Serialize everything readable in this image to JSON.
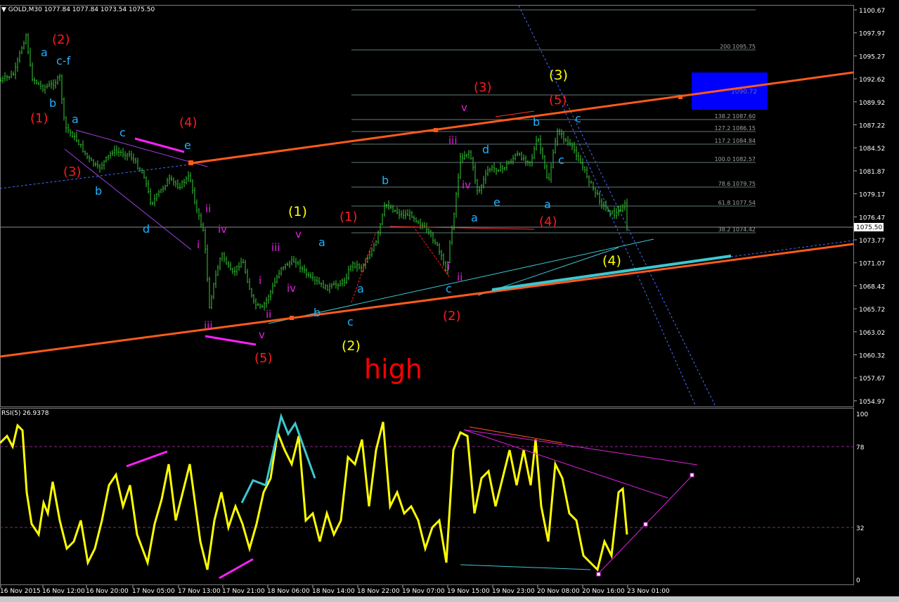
{
  "window": {
    "symbol_header": "GOLD,M30  1077.84 1077.84 1073.54 1075.50",
    "rsi_header": "RSI(5) 26.9378"
  },
  "price_axis": {
    "labels": [
      "1100.67",
      "1097.97",
      "1095.27",
      "1092.62",
      "1089.92",
      "1087.22",
      "1084.52",
      "1081.87",
      "1079.17",
      "1076.47",
      "1073.77",
      "1071.07",
      "1068.42",
      "1065.72",
      "1063.02",
      "1060.32",
      "1057.67",
      "1054.97"
    ],
    "current_price": "1075.50"
  },
  "rsi_axis": {
    "labels": [
      "100",
      "78",
      "32",
      "0"
    ]
  },
  "time_axis": {
    "labels": [
      "16 Nov 2015",
      "16 Nov 12:00",
      "16 Nov 20:00",
      "17 Nov 05:00",
      "17 Nov 13:00",
      "17 Nov 21:00",
      "18 Nov 06:00",
      "18 Nov 14:00",
      "18 Nov 22:00",
      "19 Nov 07:00",
      "19 Nov 15:00",
      "19 Nov 23:00",
      "20 Nov 08:00",
      "20 Nov 16:00",
      "23 Nov 01:00"
    ]
  },
  "fibonacci": {
    "levels": [
      "200  1095.75",
      "138.2  1087.60",
      "127.2  1086.15",
      "117.2  1084.84",
      "100.0  1082.57",
      "78.6  1079.75",
      "61.8  1077.54",
      "38.2  1074.42"
    ],
    "faded_label": "1090.72"
  },
  "annotation": {
    "big_text": "high"
  },
  "wave_labels": {
    "red": [
      "(2)",
      "(1)",
      "(3)",
      "(4)",
      "(5)",
      "(1)",
      "(2)",
      "(3)",
      "(5)",
      "(4)"
    ],
    "yellow": [
      "(1)",
      "(2)",
      "(3)",
      "(4)"
    ],
    "cyan": [
      "a",
      "c-f",
      "b",
      "a",
      "c",
      "b",
      "d",
      "e",
      "b",
      "a",
      "c",
      "a",
      "b",
      "c",
      "a",
      "d",
      "e",
      "b",
      "a",
      "c",
      "c"
    ],
    "magenta": [
      "ii",
      "i",
      "iv",
      "iii",
      "iii",
      "ii",
      "v",
      "i",
      "iv",
      "v",
      "iii",
      "iv",
      "ii",
      "v",
      "i"
    ]
  },
  "colors": {
    "candles": "#33cc33",
    "red_label": "#ff1a1a",
    "yellow_label": "#ffff00",
    "cyan_label": "#1fb0ff",
    "magenta_label": "#e020e0",
    "trendline": "#ff5a1a",
    "channel_cyan": "#3cc8d2",
    "rsi_line": "#ffff00",
    "target_box": "#0000ff"
  },
  "chart_data": {
    "type": "line",
    "title": "GOLD,M30",
    "price_series_approx": {
      "x": [
        "16 Nov 2015",
        "16 Nov 12:00",
        "16 Nov 20:00",
        "17 Nov 05:00",
        "17 Nov 13:00",
        "17 Nov 21:00",
        "18 Nov 06:00",
        "18 Nov 14:00",
        "18 Nov 22:00",
        "19 Nov 07:00",
        "19 Nov 15:00",
        "19 Nov 23:00",
        "20 Nov 08:00",
        "20 Nov 16:00",
        "23 Nov 01:00"
      ],
      "y": [
        1093.5,
        1085.5,
        1081.9,
        1080.5,
        1071.0,
        1065.8,
        1072.0,
        1068.5,
        1076.6,
        1072.5,
        1082.0,
        1082.5,
        1083.5,
        1077.5,
        1075.5
      ]
    },
    "rsi_series_approx": {
      "name": "RSI(5)",
      "x": [
        "16 Nov 2015",
        "16 Nov 12:00",
        "16 Nov 20:00",
        "17 Nov 05:00",
        "17 Nov 13:00",
        "17 Nov 21:00",
        "18 Nov 06:00",
        "18 Nov 14:00",
        "18 Nov 22:00",
        "19 Nov 07:00",
        "19 Nov 15:00",
        "19 Nov 23:00",
        "20 Nov 08:00",
        "20 Nov 16:00",
        "23 Nov 01:00"
      ],
      "y": [
        85,
        35,
        60,
        25,
        45,
        30,
        88,
        30,
        80,
        20,
        90,
        60,
        70,
        10,
        27
      ]
    },
    "ylim": [
      1054.97,
      1100.67
    ],
    "rsi_ylim": [
      0,
      100
    ]
  }
}
